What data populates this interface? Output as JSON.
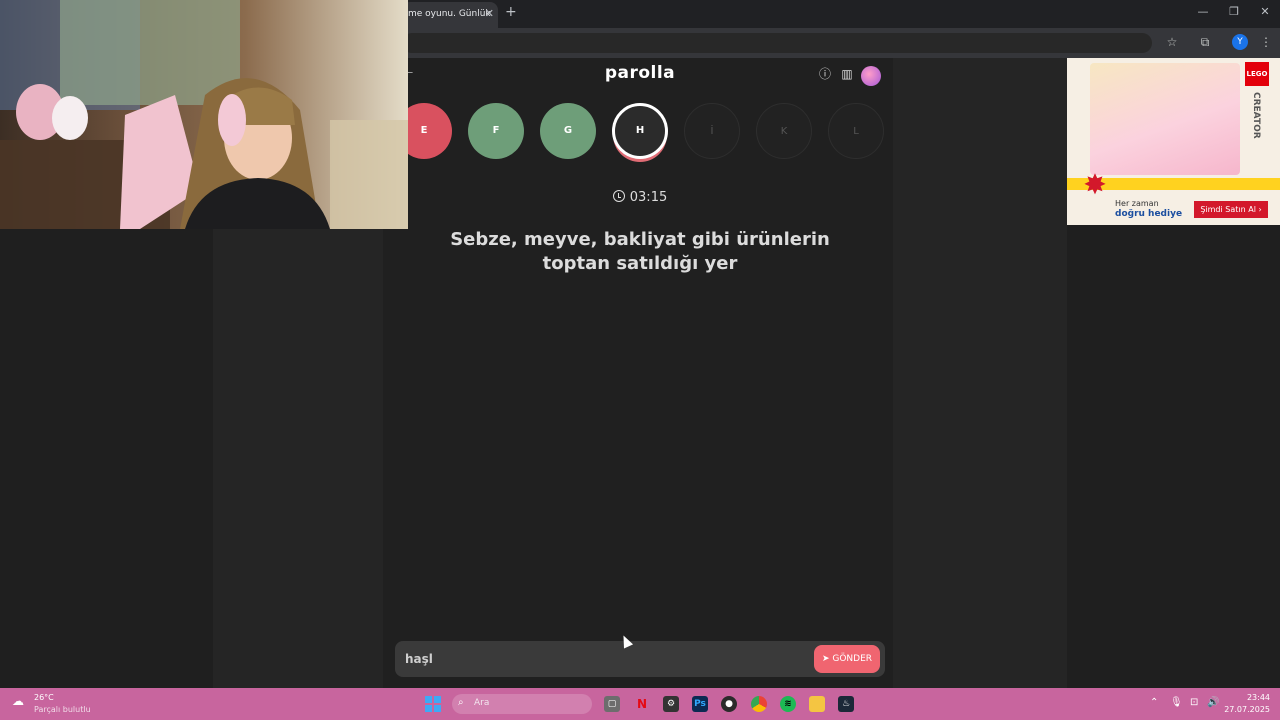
{
  "browser": {
    "tab_title": "me oyunu. Günlük",
    "tab_close": "✕",
    "new_tab": "+",
    "window_controls": [
      "—",
      "❐",
      "✕"
    ],
    "profile_initial": "Y"
  },
  "game": {
    "logo": "parolla",
    "letters": [
      {
        "label": "E",
        "state": "wrong"
      },
      {
        "label": "F",
        "state": "right"
      },
      {
        "label": "G",
        "state": "right"
      },
      {
        "label": "H",
        "state": "current"
      },
      {
        "label": "İ",
        "state": "pending"
      },
      {
        "label": "K",
        "state": "pending"
      },
      {
        "label": "L",
        "state": "pending"
      }
    ],
    "timer": "03:15",
    "question_line1": "Sebze, meyve, bakliyat gibi ürünlerin",
    "question_line2": "toptan satıldığı yer",
    "answer_value": "haşl",
    "send_label": "GÖNDER",
    "colors": {
      "wrong": "#d9515f",
      "right": "#6e9e79",
      "send": "#f06570"
    }
  },
  "ad": {
    "brand": "LEGO",
    "line": "CREATOR",
    "tagline_1": "Her zaman",
    "tagline_2": "doğru hediye",
    "cta": "Şimdi Satın Al ›"
  },
  "taskbar": {
    "temperature": "26°C",
    "weather": "Parçalı bulutlu",
    "search_placeholder": "Ara",
    "time": "23:44",
    "date": "27.07.2025"
  }
}
